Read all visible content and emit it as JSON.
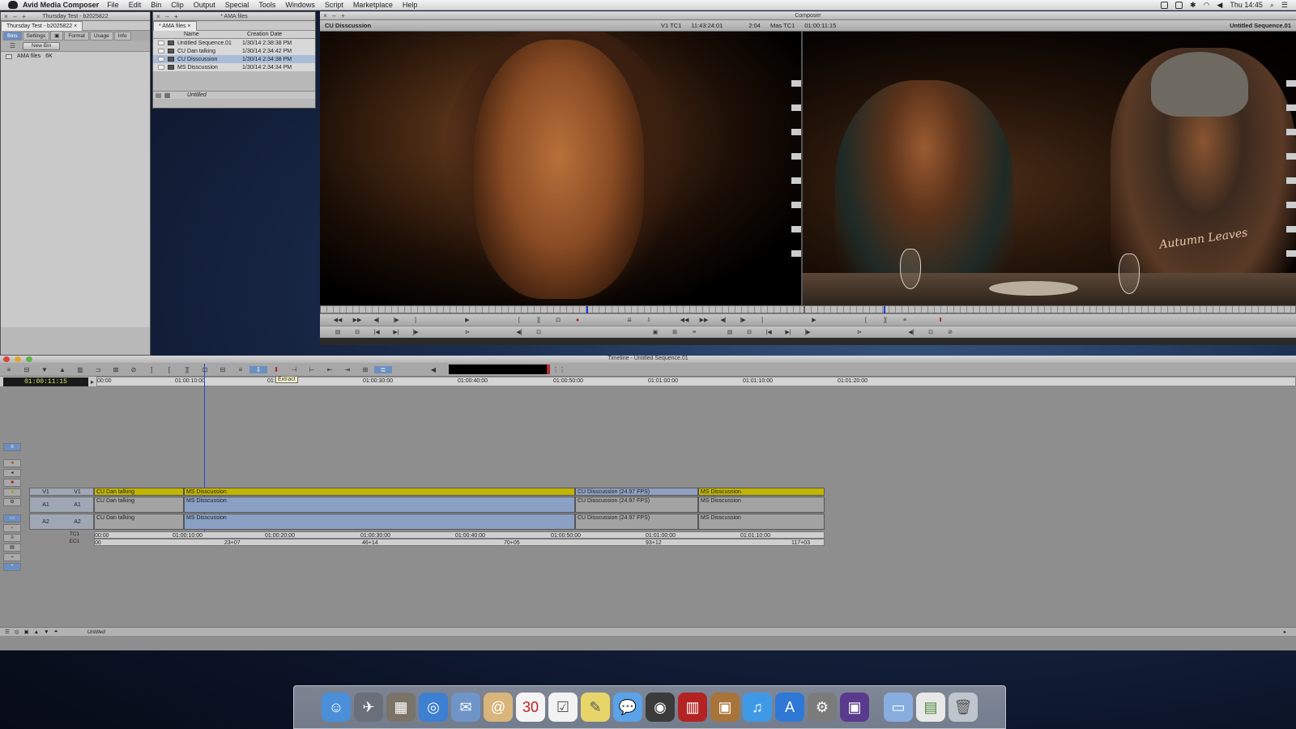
{
  "menubar": {
    "app_name": "Avid Media Composer",
    "items": [
      "File",
      "Edit",
      "Bin",
      "Clip",
      "Output",
      "Special",
      "Tools",
      "Windows",
      "Script",
      "Marketplace",
      "Help"
    ],
    "clock": "Thu 14:45"
  },
  "bin_window": {
    "title": "Thursday Test - b2025822",
    "tab": "Thursday Test - b2025822",
    "subtabs": [
      "Bins",
      "Settings",
      "Format",
      "Usage",
      "Info"
    ],
    "new_bin_label": "New Bin",
    "entries": [
      {
        "name": "AMA files",
        "size": "6K"
      }
    ]
  },
  "ama_window": {
    "title": "* AMA files",
    "tab": "* AMA files",
    "columns": [
      "Name",
      "Creation Date"
    ],
    "rows": [
      {
        "name": "Untitled Sequence.01",
        "date": "1/30/14 2:38:38 PM"
      },
      {
        "name": "CU Dan talking",
        "date": "1/30/14 2:34:42 PM"
      },
      {
        "name": "CU Disscussion",
        "date": "1/30/14 2:34:38 PM"
      },
      {
        "name": "MS Disscussion",
        "date": "1/30/14 2:34:34 PM"
      }
    ],
    "footer_label": "Untitled"
  },
  "composer": {
    "title": "Composer",
    "source_clip": "CU Disscussion",
    "v1_tc1_label": "V1 TC1",
    "v1_tc1_value": "11:43:24:01",
    "duration": "2:04",
    "mas_tc1_label": "Mas TC1",
    "mas_tc1_value": "01:00:11:15",
    "record_sequence": "Untitled Sequence.01",
    "shirt_text": "Autumn Leaves",
    "source_position_pct": 55,
    "record_position_pct": 16
  },
  "timeline": {
    "title": "Timeline - Untitled Sequence.01",
    "timecode": "01:00:11:15",
    "tooltip": "Extract",
    "ruler_labels": [
      "00:00",
      "01:00:10:00",
      "01:00:20:00",
      "01:00:30:00",
      "01:00:40:00",
      "01:00:50:00",
      "01:01:00:00",
      "01:01:10:00",
      "01:01:20:00"
    ],
    "tracks": {
      "v1": {
        "rec": "V1",
        "src": "V1"
      },
      "a1": {
        "rec": "A1",
        "src": "A1"
      },
      "a2": {
        "rec": "A2",
        "src": "A2"
      }
    },
    "clips": {
      "c1": "CU Dan talking",
      "c2": "MS Disscussion",
      "c3": "CU Disscussion (24.97 FPS)",
      "c4": "MS Disscussion"
    },
    "tc1_label": "TC1",
    "ec1_label": "EC1",
    "tc1_values": [
      "00:00",
      "01:00:10:00",
      "01:00:20:00",
      "01:00:30:00",
      "01:00:40:00",
      "01:00:50:00",
      "01:01:00:00",
      "01:01:10:00"
    ],
    "ec1_values": [
      "00",
      "23+07",
      "46+14",
      "70+05",
      "93+12",
      "117+03"
    ],
    "footer_label": "Untitled"
  },
  "colors": {
    "video_clip": "#c2b500",
    "selection": "#6b8fc2",
    "playhead": "#2a47d8",
    "timecode_text": "#d8e870"
  },
  "dock": [
    "finder-icon",
    "launchpad-icon",
    "photo-booth-icon",
    "safari-icon",
    "mail-icon",
    "contacts-icon",
    "calendar-icon",
    "reminders-icon",
    "notes-icon",
    "messages-icon",
    "facetime-icon",
    "photo-slideshow-icon",
    "iphoto-icon",
    "itunes-icon",
    "app-store-icon",
    "system-preferences-icon",
    "avid-icon",
    "folder-icon",
    "document-icon",
    "trash-icon"
  ],
  "calendar_day": "30"
}
